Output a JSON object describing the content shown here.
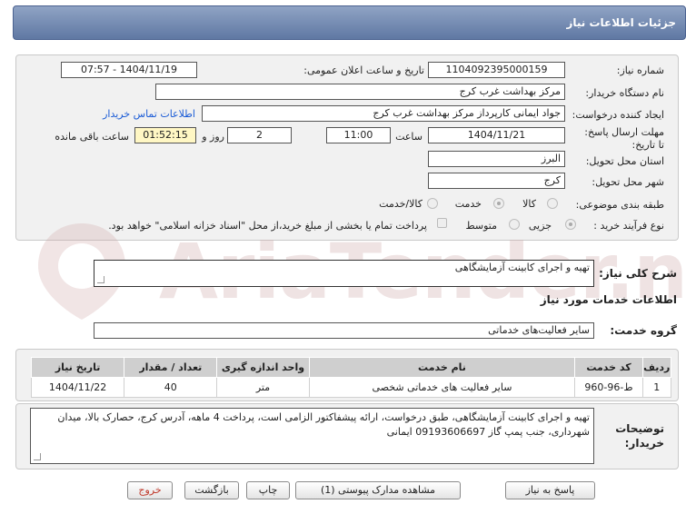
{
  "header": {
    "title": "جزئیات اطلاعات نیاز"
  },
  "form": {
    "need_number_label": "شماره نیاز:",
    "need_number": "1104092395000159",
    "announce_label": "تاریخ و ساعت اعلان عمومی:",
    "announce_value": "1404/11/19 - 07:57",
    "buyer_org_label": "نام دستگاه خریدار:",
    "buyer_org": "مرکز بهداشت غرب کرج",
    "creator_label": "ایجاد کننده درخواست:",
    "creator": "جواد ایمانی کارپرداز مرکز بهداشت غرب کرج",
    "contact_link": "اطلاعات تماس خریدار",
    "deadline_label": "مهلت ارسال پاسخ: تا تاریخ:",
    "deadline_date": "1404/11/21",
    "time_label": "ساعت",
    "deadline_time": "11:00",
    "days_value": "2",
    "days_label": "روز و",
    "remaining_time": "01:52:15",
    "remaining_label": "ساعت باقی مانده",
    "province_label": "استان محل تحویل:",
    "province": "البرز",
    "city_label": "شهر محل تحویل:",
    "city": "کرج",
    "category_label": "طبقه بندی موضوعی:",
    "category_options": [
      "کالا",
      "خدمت",
      "کالا/خدمت"
    ],
    "category_selected": "خدمت",
    "process_label": "نوع فرآیند خرید :",
    "process_options": [
      "جزیی",
      "متوسط"
    ],
    "process_selected": "جزیی",
    "payment_note": "پرداخت تمام یا بخشی از مبلغ خرید،از محل \"اسناد خزانه اسلامی\" خواهد بود."
  },
  "summary": {
    "label": "شرح کلی نیاز:",
    "value": "تهیه و اجرای کابینت آزمایشگاهی"
  },
  "services": {
    "section_title": "اطلاعات خدمات مورد نیاز",
    "group_label": "گروه خدمت:",
    "group_value": "سایر فعالیت‌های خدماتی",
    "columns": [
      "ردیف",
      "کد خدمت",
      "نام خدمت",
      "واحد اندازه گیری",
      "تعداد / مقدار",
      "تاریخ نیاز"
    ],
    "rows": [
      [
        "1",
        "ط-96-960",
        "سایر فعالیت های خدماتی شخصی",
        "متر",
        "40",
        "1404/11/22"
      ]
    ]
  },
  "buyer_notes": {
    "label": "توضیحات خریدار:",
    "value": "تهیه و اجرای کابینت آزمایشگاهی، طبق درخواست، ارائه پیشفاکتور الزامی است، پرداخت 4 ماهه، آدرس کرج، حصارک بالا، میدان شهرداری، جنب پمپ گاز 09193606697 ایمانی"
  },
  "buttons": {
    "reply": "پاسخ به نیاز",
    "attachments": "مشاهده مدارک پیوستی (1)",
    "print": "چاپ",
    "back": "بازگشت",
    "exit": "خروج"
  },
  "watermark": {
    "text": "AriaTender.net"
  },
  "colors": {
    "header_bg": "#6f86ad",
    "exit_text": "#c0392b",
    "link": "#1a5bd6",
    "remaining_bg": "#fff7c4"
  }
}
